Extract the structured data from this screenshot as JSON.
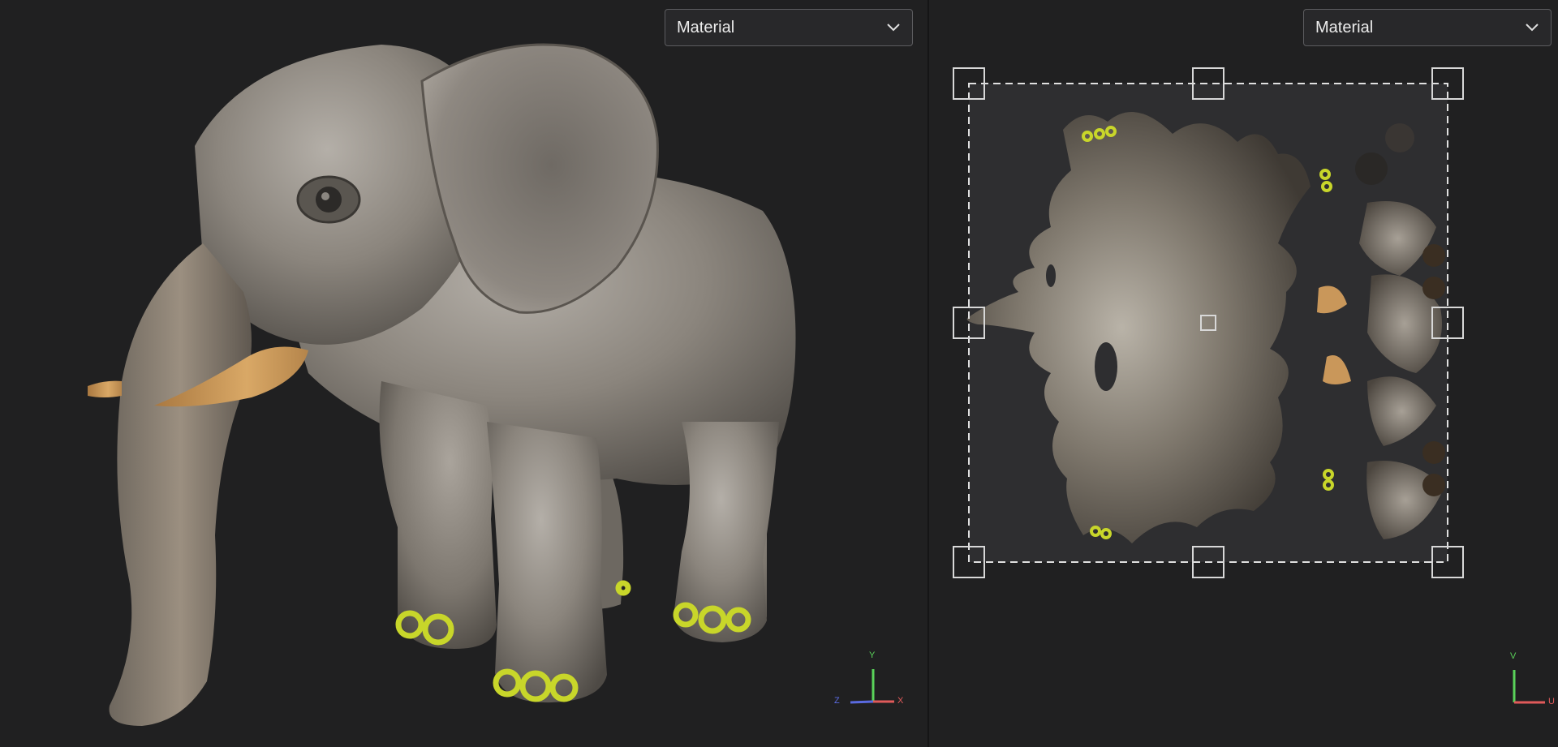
{
  "viewport_3d": {
    "dropdown": {
      "selected": "Material"
    },
    "gizmo": {
      "y_label": "Y",
      "z_label": "Z",
      "x_label": "X"
    }
  },
  "viewport_uv": {
    "dropdown": {
      "selected": "Material"
    },
    "gizmo": {
      "v_label": "V",
      "u_label": "U"
    }
  },
  "colors": {
    "background": "#202021",
    "axis_x": "#e05a5a",
    "axis_y": "#5ad35a",
    "axis_z": "#5a6ae0",
    "accent_yellow": "#c8d62a",
    "tusk": "#c9975a"
  },
  "icons": [
    "chevron-down-icon",
    "axis-gizmo-icon",
    "uv-gizmo-icon"
  ]
}
